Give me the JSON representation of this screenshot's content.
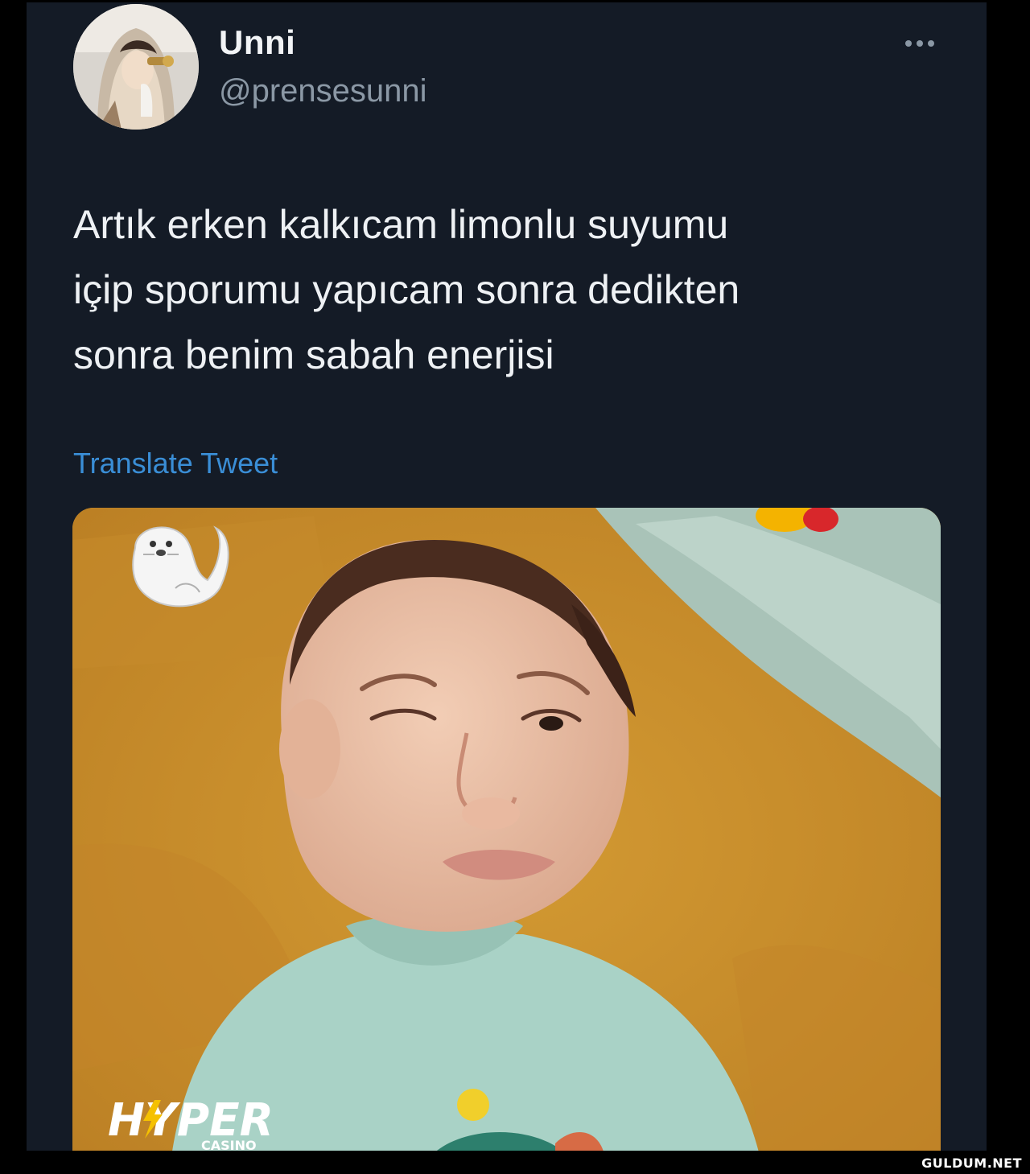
{
  "user": {
    "display_name": "Unni",
    "handle": "@prensesunni"
  },
  "tweet": {
    "text": "Artık erken kalkıcam limonlu suyumu\niçip sporumu yapıcam sonra dedikten\nsonra benim sabah enerjisi",
    "translate_label": "Translate Tweet"
  },
  "icons": {
    "more": "more-options-icon",
    "seal": "seal-emoji-icon"
  },
  "overlay": {
    "logo_word": "HYPER",
    "logo_sub": "CASINO",
    "watermark": "GULDUM.NET"
  },
  "colors": {
    "background": "#141b26",
    "text": "#eef1f4",
    "muted": "#8b98a5",
    "link": "#3a8ed6"
  }
}
